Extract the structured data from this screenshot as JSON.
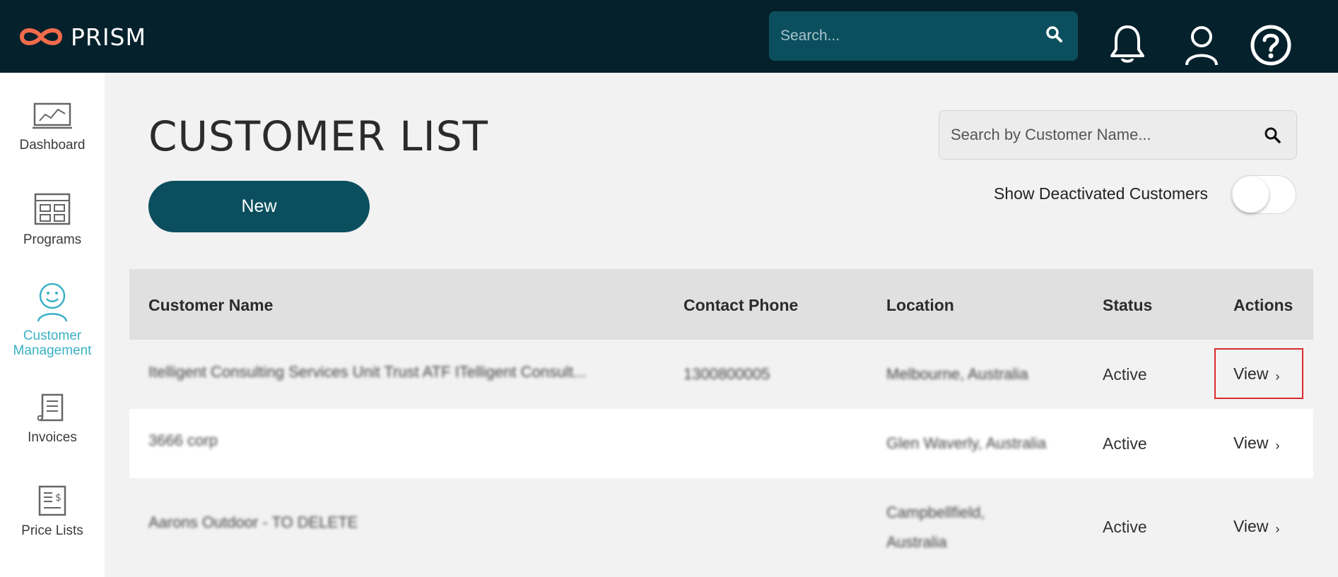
{
  "app": {
    "name": "PRISM",
    "brand_color": "#05212c",
    "accent": "#0b4f5e",
    "active_nav_color": "#3ab1c4"
  },
  "header": {
    "search": {
      "placeholder": "Search..."
    },
    "icons": [
      "bell-icon",
      "user-icon",
      "help-icon"
    ]
  },
  "sidebar": {
    "items": [
      {
        "label": "Dashboard",
        "icon": "dashboard-chart-icon",
        "active": false
      },
      {
        "label": "Programs",
        "icon": "programs-grid-icon",
        "active": false
      },
      {
        "label": "Customer Management",
        "icon": "customer-face-icon",
        "active": true
      },
      {
        "label": "Invoices",
        "icon": "invoice-scroll-icon",
        "active": false
      },
      {
        "label": "Price Lists",
        "icon": "price-list-icon",
        "active": false
      }
    ]
  },
  "main": {
    "title": "CUSTOMER LIST",
    "new_button": "New",
    "customer_search": {
      "placeholder": "Search by Customer Name..."
    },
    "show_deactivated": {
      "label": "Show Deactivated Customers",
      "on": false
    }
  },
  "table": {
    "headers": [
      "Customer Name",
      "Contact Phone",
      "Location",
      "Status",
      "Actions"
    ],
    "rows": [
      {
        "name": "Itelligent Consulting Services Unit Trust ATF ITelligent Consult...",
        "phone": "1300800005",
        "location": "Melbourne, Australia",
        "status": "Active",
        "action": "View",
        "highlighted": true
      },
      {
        "name": "3666 corp",
        "phone": "",
        "location": "Glen Waverly, Australia",
        "status": "Active",
        "action": "View",
        "highlighted": false
      },
      {
        "name": "Aarons Outdoor - TO DELETE",
        "phone": "",
        "location_line1": "Campbellfield,",
        "location_line2": "Australia",
        "status": "Active",
        "action": "View",
        "highlighted": false
      }
    ]
  }
}
